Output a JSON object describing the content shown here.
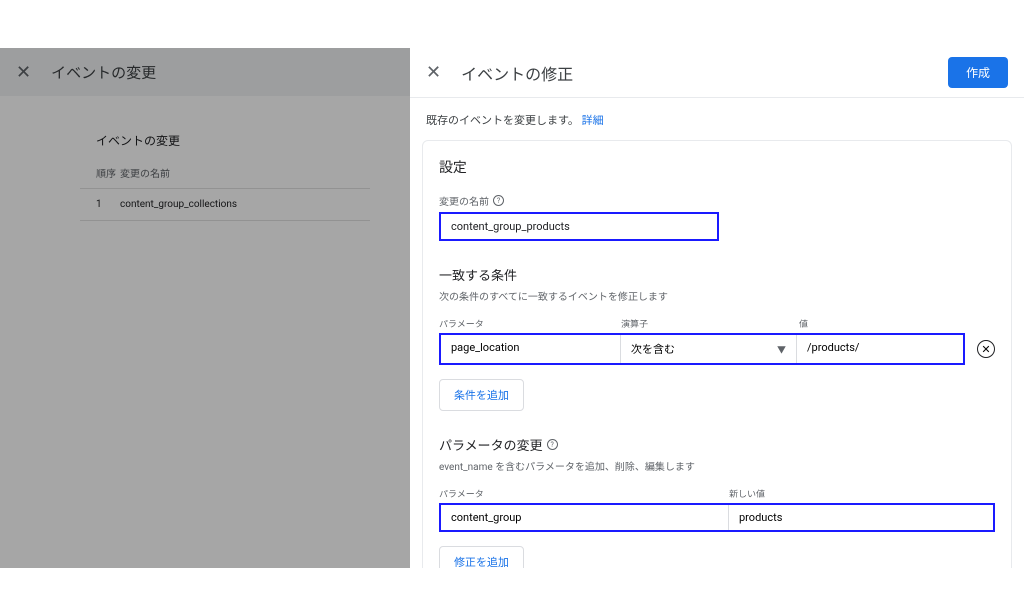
{
  "left": {
    "title": "イベントの変更",
    "card_title": "イベントの変更",
    "col_order": "順序",
    "col_name": "変更の名前",
    "rows": [
      {
        "order": "1",
        "name": "content_group_collections"
      }
    ]
  },
  "right": {
    "title": "イベントの修正",
    "create_label": "作成",
    "subtitle_text": "既存のイベントを変更します。",
    "subtitle_link": "詳細",
    "settings_title": "設定",
    "name_label": "変更の名前",
    "name_value": "content_group_products",
    "conditions": {
      "title": "一致する条件",
      "desc": "次の条件のすべてに一致するイベントを修正します",
      "label_param": "パラメータ",
      "label_op": "演算子",
      "label_val": "値",
      "rows": [
        {
          "param": "page_location",
          "op": "次を含む",
          "val": "/products/"
        }
      ],
      "add_label": "条件を追加"
    },
    "params": {
      "title": "パラメータの変更",
      "desc": "event_name を含むパラメータを追加、削除、編集します",
      "label_param": "パラメータ",
      "label_val": "新しい値",
      "rows": [
        {
          "param": "content_group",
          "val": "products"
        }
      ],
      "add_label": "修正を追加"
    }
  }
}
